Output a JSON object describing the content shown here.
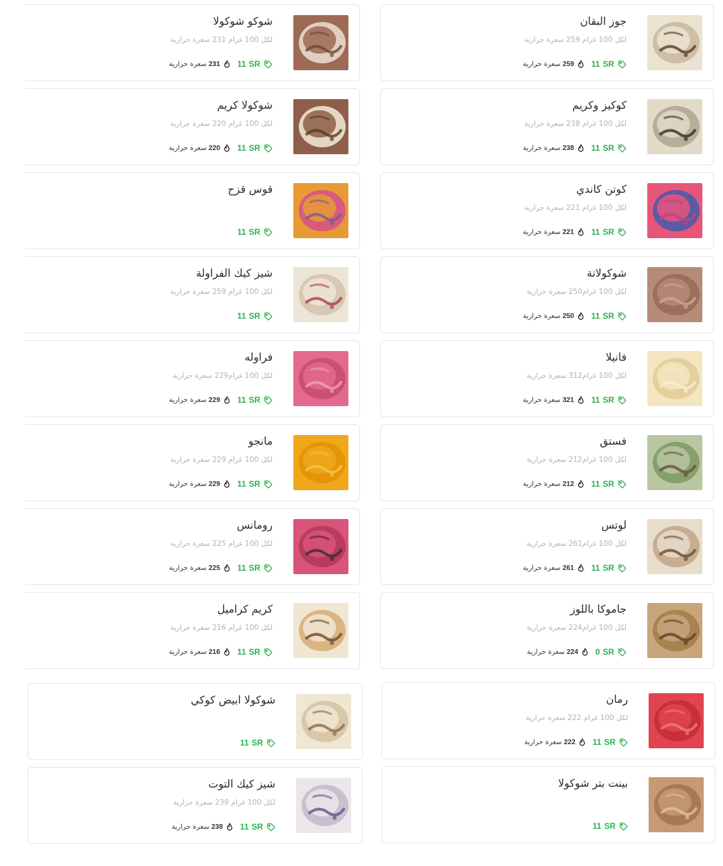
{
  "currency_label": "SR",
  "calories_word": "سعرة حرارية",
  "colors": {
    "accent": "#2cb34a",
    "text": "#2b2b2b",
    "muted": "#b2b2b2",
    "border": "#e6e6e6"
  },
  "icons": {
    "price": "price-tag-icon",
    "calories": "flame-icon"
  },
  "products": [
    {
      "name": "جوز البقان",
      "desc": "لكل 100 غرام 259 سعرة حرارية",
      "price": "11",
      "calories": "259",
      "palette": [
        "#ebe3d2",
        "#cdbfa5",
        "#5b3a24"
      ]
    },
    {
      "name": "شوكو شوكولا",
      "desc": "لكل 100 غرام 231 سعرة حرارية",
      "price": "11",
      "calories": "231",
      "palette": [
        "#9c6a55",
        "#e0cfc0",
        "#6e4332"
      ]
    },
    {
      "name": "كوكيز وكريم",
      "desc": "لكل 100 غرام 238 سعرة حرارية",
      "price": "11",
      "calories": "238",
      "palette": [
        "#e2dbc8",
        "#b7ad98",
        "#3a2b22"
      ]
    },
    {
      "name": "شوكولا كريم",
      "desc": "لكل 100 غرام 220 سعرة حرارية",
      "price": "11",
      "calories": "220",
      "palette": [
        "#8d5f48",
        "#e5d6c3",
        "#5a3627"
      ]
    },
    {
      "name": "كوتن كاندي",
      "desc": "لكل 100 غرام 221 سعرة حرارية",
      "price": "11",
      "calories": "221",
      "palette": [
        "#e8557a",
        "#5b5aa6",
        "#c2417a"
      ]
    },
    {
      "name": "قوس قزح",
      "desc": "",
      "price": "11",
      "calories": "",
      "palette": [
        "#e89a37",
        "#d85b7f",
        "#7a5b8c"
      ]
    },
    {
      "name": "شوكولاتة",
      "desc": "لكل 100 غرام250 سعرة حرارية",
      "price": "11",
      "calories": "250",
      "palette": [
        "#b58c78",
        "#9a6f5c",
        "#c9a897"
      ]
    },
    {
      "name": "شيز كيك الفراولة",
      "desc": "لكل 100 غرام 259 سعرة حرارية",
      "price": "11",
      "calories": "",
      "palette": [
        "#ede5d6",
        "#d6c8b2",
        "#b23b4e"
      ]
    },
    {
      "name": "فانيلا",
      "desc": "لكل 100 غرام312 سعرة حرارية",
      "price": "11",
      "calories": "321",
      "palette": [
        "#f3e6c0",
        "#e4d09d",
        "#f7efd6"
      ]
    },
    {
      "name": "فراوله",
      "desc": "لكل 100 غرام229 سعرة حرارية",
      "price": "11",
      "calories": "229",
      "palette": [
        "#e36a8e",
        "#c94f74",
        "#f0a0b8"
      ]
    },
    {
      "name": "فستق",
      "desc": "لكل 100 غرام212 سعرة حرارية",
      "price": "11",
      "calories": "212",
      "palette": [
        "#b9c6a2",
        "#86a06b",
        "#6b4c3a"
      ]
    },
    {
      "name": "مانجو",
      "desc": "لكل 100 غرام 229 سعرة حرارية",
      "price": "11",
      "calories": "229",
      "palette": [
        "#f0a81b",
        "#e59408",
        "#f7c348"
      ]
    },
    {
      "name": "لوتس",
      "desc": "لكل 100 غرام261 سعرة حرارية",
      "price": "11",
      "calories": "261",
      "palette": [
        "#e8dccb",
        "#c7ae90",
        "#6a4a33"
      ]
    },
    {
      "name": "رومانس",
      "desc": "لكل 100 غرام 225 سعرة حرارية",
      "price": "11",
      "calories": "225",
      "palette": [
        "#d9547a",
        "#b83a5c",
        "#3e2a2a"
      ]
    },
    {
      "name": "جاموكا باللوز",
      "desc": "لكل 100 غرام224 سعرة حرارية",
      "price": "0",
      "calories": "224",
      "palette": [
        "#c9a57c",
        "#a8824f",
        "#5a3e27"
      ]
    },
    {
      "name": "كريم كراميل",
      "desc": "لكل 100 غرام 216 سعرة حرارية",
      "price": "11",
      "calories": "216",
      "palette": [
        "#f1e6d2",
        "#d9b582",
        "#6d4a2c"
      ]
    },
    {
      "name": "رمان",
      "desc": "لكل 100 غرام 222 سعرة حرارية",
      "price": "11",
      "calories": "222",
      "palette": [
        "#e0454f",
        "#c72f3a",
        "#f07a80"
      ]
    },
    {
      "name": "شوكولا ابيض كوكي",
      "desc": "",
      "price": "11",
      "calories": "",
      "palette": [
        "#f0e6d4",
        "#d8c7a9",
        "#8b6a4a"
      ]
    },
    {
      "name": "بينت بتر شوكولا",
      "desc": "",
      "price": "11",
      "calories": "",
      "palette": [
        "#c69a73",
        "#a97a52",
        "#e0c09f"
      ]
    },
    {
      "name": "شيز كيك التوت",
      "desc": "لكل 100 غرام 238 سعرة حرارية",
      "price": "11",
      "calories": "238",
      "palette": [
        "#ece6ea",
        "#c8c0cf",
        "#6b4e8c"
      ]
    }
  ]
}
